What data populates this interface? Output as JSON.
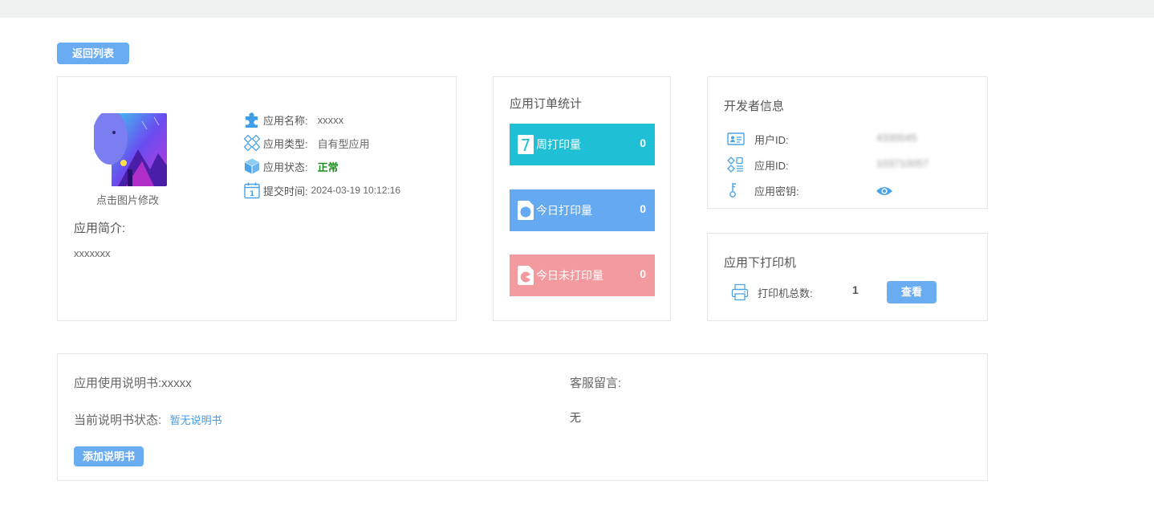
{
  "toolbar": {
    "back_label": "返回列表"
  },
  "app": {
    "thumb_hint": "点击图片修改",
    "name_label": "应用名称:",
    "name_value": "xxxxx",
    "type_label": "应用类型:",
    "type_value": "自有型应用",
    "status_label": "应用状态:",
    "status_value": "正常",
    "submit_label": "提交时间:",
    "submit_value": "2024-03-19 10:12:16",
    "intro_title": "应用简介:",
    "intro_text": "xxxxxxx",
    "status_color": "#1e8e1e"
  },
  "orders": {
    "title": "应用订单统计",
    "items": [
      {
        "label": "周打印量",
        "value": "0",
        "color": "#1fbfd6",
        "icon": "calendar-7-icon"
      },
      {
        "label": "今日打印量",
        "value": "0",
        "color": "#65a9f1",
        "icon": "circle-doc-icon"
      },
      {
        "label": "今日未打印量",
        "value": "0",
        "color": "#f29a9e",
        "icon": "pie-doc-icon"
      }
    ]
  },
  "developer": {
    "title": "开发者信息",
    "user_id_label": "用户ID:",
    "user_id_value": "4330045",
    "app_id_label": "应用ID:",
    "app_id_value": "103710057",
    "secret_label": "应用密钥:"
  },
  "printers": {
    "title": "应用下打印机",
    "total_label": "打印机总数:",
    "total_value": "1",
    "view_label": "查看"
  },
  "manual": {
    "label": "应用使用说明书:",
    "value": "xxxxx",
    "status_label": "当前说明书状态:",
    "status_value": "暂无说明书",
    "add_label": "添加说明书",
    "service_label": "客服留言:",
    "service_value": "无",
    "link_color": "#4a9ae0"
  },
  "colors": {
    "accent": "#6aacf2",
    "icon_blue": "#4aa3e6"
  }
}
